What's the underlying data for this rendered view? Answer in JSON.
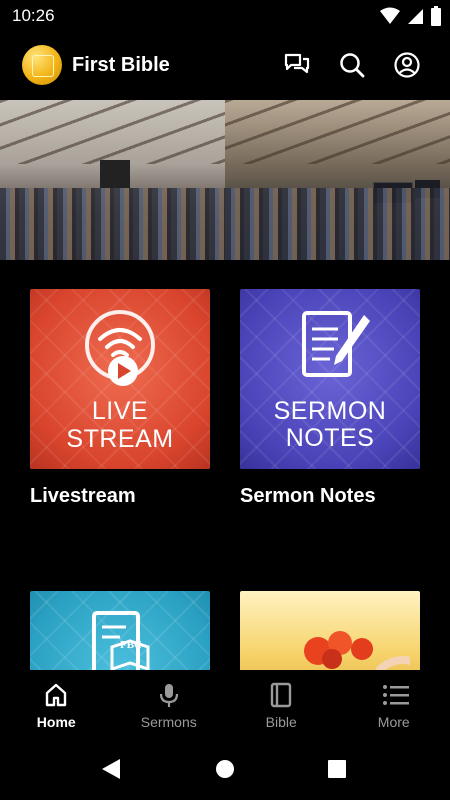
{
  "status": {
    "time": "10:26"
  },
  "header": {
    "title": "First Bible"
  },
  "cards": [
    {
      "tile_line1": "LIVE",
      "tile_line2": "STREAM",
      "label": "Livestream"
    },
    {
      "tile_line1": "SERMON",
      "tile_line2": "NOTES",
      "label": "Sermon Notes"
    },
    {
      "badge": "FBC"
    }
  ],
  "nav": {
    "home": "Home",
    "sermons": "Sermons",
    "bible": "Bible",
    "more": "More"
  },
  "colors": {
    "live": "#d9442d",
    "notes": "#4a43b8",
    "bible": "#2aa0c2",
    "logo": "#f2b416"
  }
}
